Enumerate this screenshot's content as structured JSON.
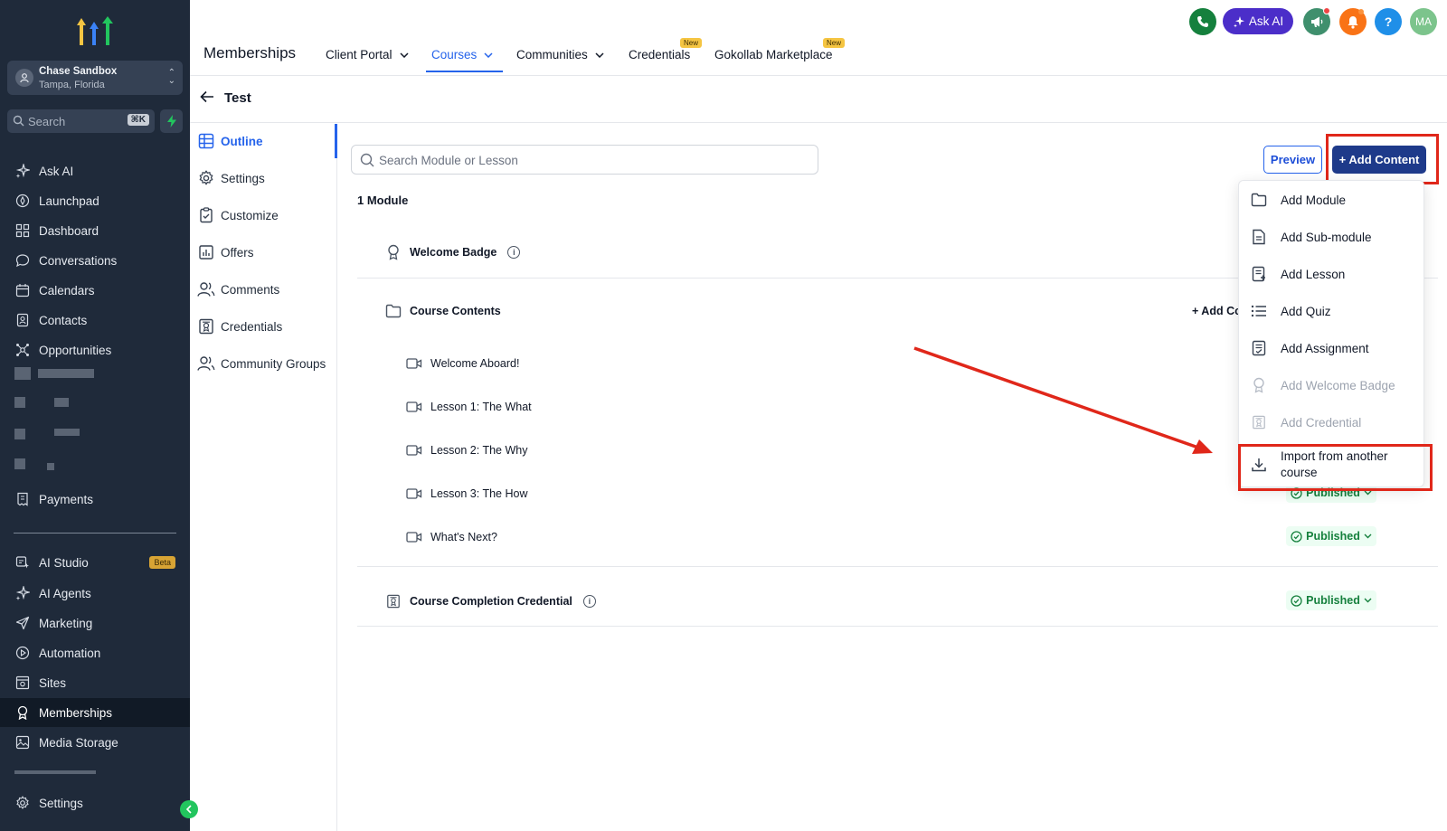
{
  "sidebar": {
    "account": {
      "name": "Chase Sandbox",
      "location": "Tampa, Florida"
    },
    "search": {
      "placeholder": "Search",
      "shortcut": "⌘K"
    },
    "items": [
      {
        "label": "Ask AI",
        "icon": "sparkle-icon"
      },
      {
        "label": "Launchpad",
        "icon": "rocket-icon"
      },
      {
        "label": "Dashboard",
        "icon": "grid-icon"
      },
      {
        "label": "Conversations",
        "icon": "chat-icon"
      },
      {
        "label": "Calendars",
        "icon": "calendar-icon"
      },
      {
        "label": "Contacts",
        "icon": "contacts-icon"
      },
      {
        "label": "Opportunities",
        "icon": "network-icon"
      },
      {
        "label": "Payments",
        "icon": "receipt-icon"
      }
    ],
    "items2": [
      {
        "label": "AI Studio",
        "icon": "ai-studio-icon",
        "badge": "Beta"
      },
      {
        "label": "AI Agents",
        "icon": "sparkle-icon"
      },
      {
        "label": "Marketing",
        "icon": "send-icon"
      },
      {
        "label": "Automation",
        "icon": "automation-icon"
      },
      {
        "label": "Sites",
        "icon": "sites-icon"
      },
      {
        "label": "Memberships",
        "icon": "award-icon"
      },
      {
        "label": "Media Storage",
        "icon": "image-icon"
      }
    ],
    "settings": "Settings",
    "accent": "#22c55e"
  },
  "topbar": {
    "title": "Memberships",
    "tabs": [
      {
        "label": "Client Portal",
        "dropdown": true
      },
      {
        "label": "Courses",
        "dropdown": true,
        "active": true
      },
      {
        "label": "Communities",
        "dropdown": true
      },
      {
        "label": "Credentials",
        "badge": "New"
      },
      {
        "label": "Gokollab Marketplace",
        "badge": "New"
      }
    ],
    "ask_ai": "Ask AI",
    "avatar_initials": "MA",
    "help": "?"
  },
  "course": {
    "title": "Test",
    "nav": [
      {
        "label": "Outline",
        "icon": "table-icon",
        "active": true
      },
      {
        "label": "Settings",
        "icon": "gear-icon"
      },
      {
        "label": "Customize",
        "icon": "clipboard-icon"
      },
      {
        "label": "Offers",
        "icon": "chart-icon"
      },
      {
        "label": "Comments",
        "icon": "users-icon"
      },
      {
        "label": "Credentials",
        "icon": "certificate-icon"
      },
      {
        "label": "Community Groups",
        "icon": "users-icon"
      }
    ],
    "search_placeholder": "Search Module or Lesson",
    "preview": "Preview",
    "add_content": "+ Add Content",
    "module_count": "1 Module",
    "welcome_badge": "Welcome Badge",
    "module_title": "Course Contents",
    "add_content_partial": "+ Add Co",
    "lessons": [
      {
        "title": "Welcome Aboard!"
      },
      {
        "title": "Lesson 1: The What"
      },
      {
        "title": "Lesson 2: The Why"
      },
      {
        "title": "Lesson 3: The How",
        "status": "Published"
      },
      {
        "title": "What's Next?",
        "status": "Published"
      }
    ],
    "credential": {
      "title": "Course Completion Credential",
      "status": "Published"
    }
  },
  "dropdown": {
    "items": [
      {
        "label": "Add Module",
        "icon": "folder-icon"
      },
      {
        "label": "Add Sub-module",
        "icon": "document-icon"
      },
      {
        "label": "Add Lesson",
        "icon": "lesson-icon"
      },
      {
        "label": "Add Quiz",
        "icon": "list-icon"
      },
      {
        "label": "Add Assignment",
        "icon": "assignment-icon"
      },
      {
        "label": "Add Welcome Badge",
        "icon": "badge-icon",
        "disabled": true
      },
      {
        "label": "Add Credential",
        "icon": "certificate-icon",
        "disabled": true
      },
      {
        "label": "Import from another course",
        "icon": "download-icon"
      }
    ]
  },
  "colors": {
    "sidebar_bg": "#1f2a3a",
    "primary": "#2563eb",
    "add_content_bg": "#1e3a8a",
    "annotation": "#e0271a",
    "published": "#15803d"
  }
}
